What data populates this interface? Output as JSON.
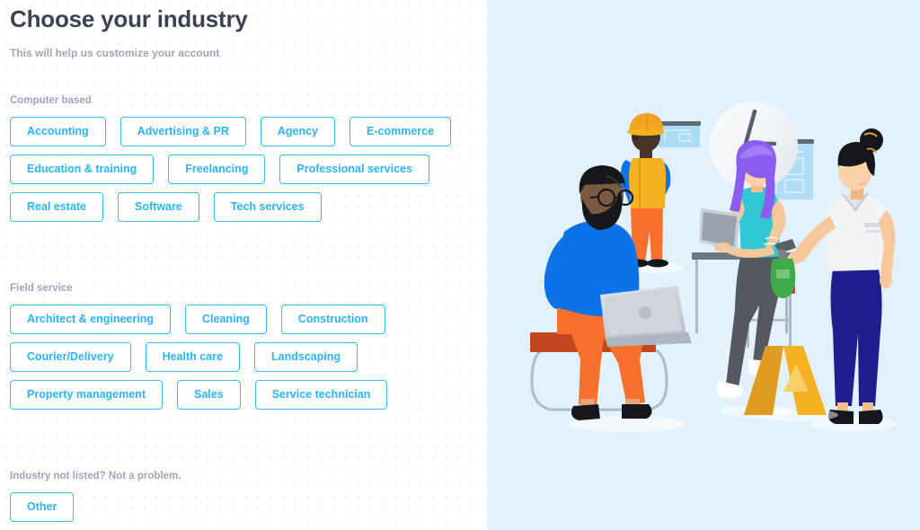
{
  "header": {
    "title": "Choose your industry",
    "subtitle": "This will help us customize your account"
  },
  "sections": [
    {
      "label": "Computer based",
      "rows": [
        [
          "Accounting",
          "Advertising & PR",
          "Agency",
          "E-commerce"
        ],
        [
          "Education & training",
          "Freelancing",
          "Professional services"
        ],
        [
          "Real estate",
          "Software",
          "Tech services"
        ]
      ]
    },
    {
      "label": "Field service",
      "rows": [
        [
          "Architect & engineering",
          "Cleaning",
          "Construction"
        ],
        [
          "Courier/Delivery",
          "Health care",
          "Landscaping"
        ],
        [
          "Property management",
          "Sales",
          "Service technician"
        ]
      ]
    },
    {
      "label": "Industry not listed? Not a problem.",
      "rows": [
        [
          "Other"
        ]
      ]
    }
  ],
  "chips": {
    "computer": {
      "row1": {
        "c1": "Accounting",
        "c2": "Advertising & PR",
        "c3": "Agency",
        "c4": "E-commerce"
      },
      "row2": {
        "c1": "Education & training",
        "c2": "Freelancing",
        "c3": "Professional services"
      },
      "row3": {
        "c1": "Real estate",
        "c2": "Software",
        "c3": "Tech services"
      }
    },
    "field": {
      "row1": {
        "c1": "Architect & engineering",
        "c2": "Cleaning",
        "c3": "Construction"
      },
      "row2": {
        "c1": "Courier/Delivery",
        "c2": "Health care",
        "c3": "Landscaping"
      },
      "row3": {
        "c1": "Property management",
        "c2": "Sales",
        "c3": "Service technician"
      }
    },
    "other": {
      "c1": "Other"
    }
  },
  "labels": {
    "computer_based": "Computer based",
    "field_service": "Field service",
    "not_listed": "Industry not listed? Not a problem."
  },
  "illustration": {
    "name": "team-at-work-illustration",
    "description": "Illustration of four workers: a construction worker with hard hat and tablet, a bearded man seated on a bench with a laptop, a woman with purple hair holding a tablet leaning on a stool, and a woman in a polo shirt holding a spray bottle next to a yellow caution sign"
  },
  "colors": {
    "accent_blue": "#35bcf7",
    "chip_text": "#2eb3f2",
    "title": "#3b4351",
    "muted": "#9ba7b6",
    "panel_bg": "#e2f1fb",
    "page_bg": "#ffffff",
    "orange": "#f8702d",
    "bright_blue": "#0b72e7",
    "navy": "#1d1f91",
    "teal": "#31c6d4",
    "purple": "#8b5cf0",
    "yellow": "#f4b223",
    "green": "#3faa49"
  }
}
